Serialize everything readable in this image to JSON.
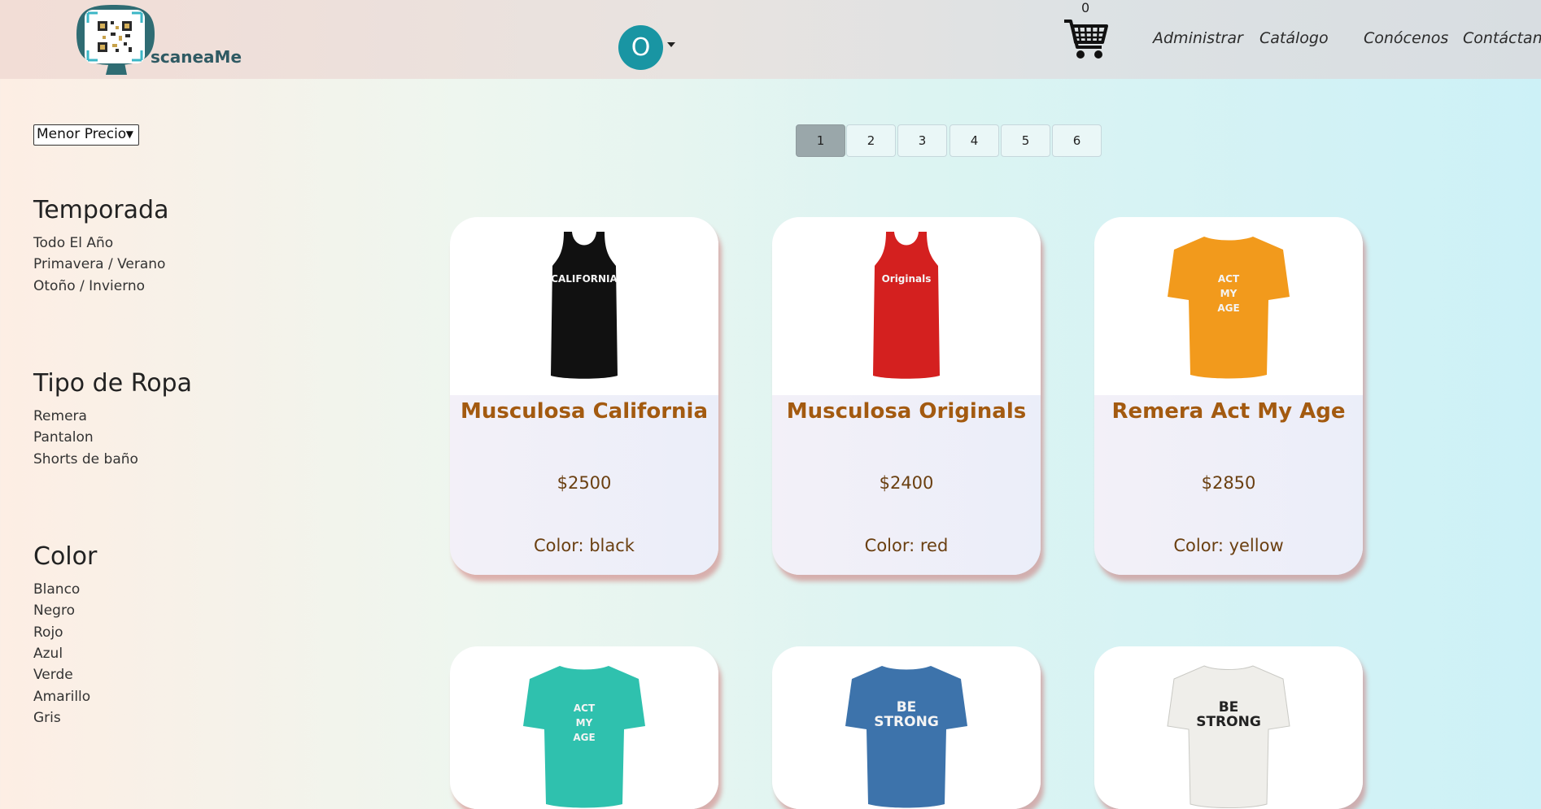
{
  "header": {
    "brand": "scaneaMe",
    "avatar_initial": "O",
    "cart_count": "0",
    "nav": [
      "Administrar",
      "Catálogo",
      "Conócenos",
      "Contáctanos"
    ]
  },
  "sidebar": {
    "sort_value": "Menor Precio",
    "groups": [
      {
        "title": "Temporada",
        "items": [
          "Todo El Año",
          "Primavera / Verano",
          "Otoño / Invierno"
        ]
      },
      {
        "title": "Tipo de Ropa",
        "items": [
          "Remera",
          "Pantalon",
          "Shorts de baño"
        ]
      },
      {
        "title": "Color",
        "items": [
          "Blanco",
          "Negro",
          "Rojo",
          "Azul",
          "Verde",
          "Amarillo",
          "Gris"
        ]
      }
    ]
  },
  "pagination": {
    "pages": [
      "1",
      "2",
      "3",
      "4",
      "5",
      "6"
    ],
    "active": "1"
  },
  "products": [
    {
      "title": "Musculosa California",
      "price": "$2500",
      "color": "Color: black",
      "shirt_color": "#111111",
      "style": "tank",
      "print": "CALIFORNIA"
    },
    {
      "title": "Musculosa Originals",
      "price": "$2400",
      "color": "Color: red",
      "shirt_color": "#d4201f",
      "style": "tank",
      "print": "Originals"
    },
    {
      "title": "Remera Act My Age",
      "price": "$2850",
      "color": "Color: yellow",
      "shirt_color": "#f29a1c",
      "style": "tee",
      "print": "ACT MY AGE"
    },
    {
      "title": "",
      "price": "",
      "color": "",
      "shirt_color": "#2fc1ae",
      "style": "tee",
      "print": "ACT MY AGE"
    },
    {
      "title": "",
      "price": "",
      "color": "",
      "shirt_color": "#3d73ab",
      "style": "tee",
      "print": "BE STRONG"
    },
    {
      "title": "",
      "price": "",
      "color": "",
      "shirt_color": "#efeeea",
      "style": "tee",
      "print": "BE STRONG"
    }
  ],
  "colors": {
    "accent_title": "#a35a10",
    "avatar_bg": "#1995a3"
  }
}
